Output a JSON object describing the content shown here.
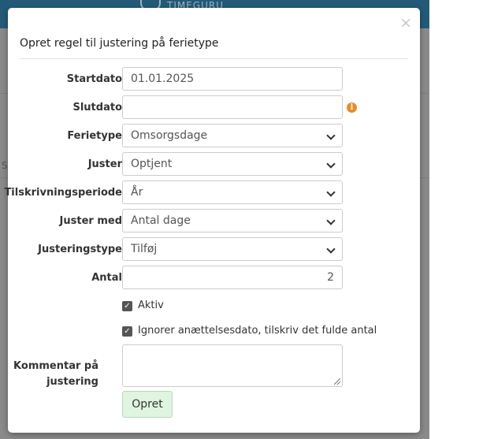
{
  "background": {
    "logo_text": "TIMEGURU",
    "partial_text": "S"
  },
  "modal": {
    "title": "Opret regel til justering på ferietype",
    "close_glyph": "×"
  },
  "form": {
    "startdato": {
      "label": "Startdato",
      "value": "01.01.2025"
    },
    "slutdato": {
      "label": "Slutdato",
      "value": ""
    },
    "ferietype": {
      "label": "Ferietype",
      "value": "Omsorgsdage"
    },
    "juster": {
      "label": "Juster",
      "value": "Optjent"
    },
    "tilskrivningsperiode": {
      "label": "Tilskrivningsperiode",
      "value": "År"
    },
    "juster_med": {
      "label": "Juster med",
      "value": "Antal dage"
    },
    "justeringstype": {
      "label": "Justeringstype",
      "value": "Tilføj"
    },
    "antal": {
      "label": "Antal",
      "value": "2"
    },
    "aktiv": {
      "label": "Aktiv",
      "checked": true
    },
    "ignorer": {
      "label": "Ignorer anættelsesdato, tilskriv det fulde antal",
      "checked": true
    },
    "kommentar": {
      "label_line1": "Kommentar på",
      "label_line2": "justering",
      "value": ""
    },
    "submit_label": "Opret"
  },
  "icons": {
    "info_glyph": "i",
    "check_glyph": "✓"
  },
  "colors": {
    "info": "#e98b2a",
    "submit_bg": "#dff5df",
    "header_bg": "#245a78"
  }
}
